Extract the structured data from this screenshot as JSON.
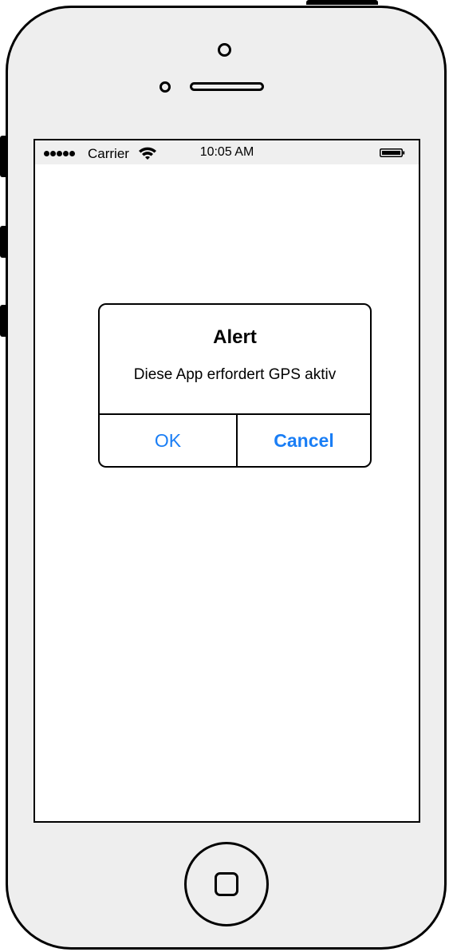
{
  "statusbar": {
    "carrier": "Carrier",
    "time": "10:05 AM",
    "icons": [
      "signal-dots-icon",
      "wifi-icon",
      "battery-icon"
    ]
  },
  "alert": {
    "title": "Alert",
    "message": "Diese App erfordert GPS aktiv",
    "ok_label": "OK",
    "cancel_label": "Cancel"
  },
  "colors": {
    "accent": "#1a7ef5",
    "phone_body": "#eeeeee",
    "outline": "#000000",
    "statusbar_bg": "#efefef"
  }
}
